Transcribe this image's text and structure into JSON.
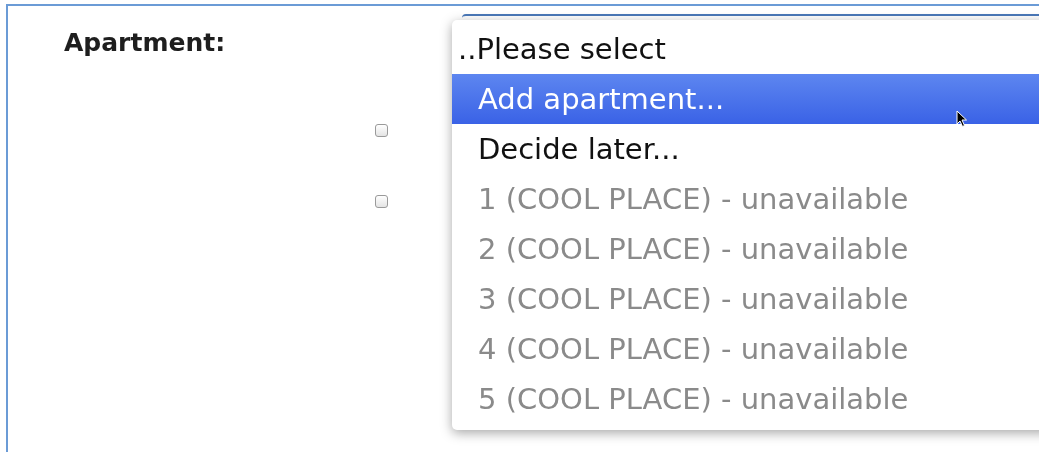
{
  "field": {
    "label": "Apartment:"
  },
  "checkboxes": [
    {
      "checked": false
    },
    {
      "checked": false
    }
  ],
  "dropdown": {
    "options": [
      {
        "kind": "current",
        "label": "..Please select",
        "selected": false,
        "disabled": false
      },
      {
        "kind": "option",
        "label": "Add apartment...",
        "selected": true,
        "disabled": false
      },
      {
        "kind": "option",
        "label": "Decide later...",
        "selected": false,
        "disabled": false
      },
      {
        "kind": "option",
        "label": "1 (COOL PLACE) - unavailable",
        "selected": false,
        "disabled": true
      },
      {
        "kind": "option",
        "label": "2 (COOL PLACE) - unavailable",
        "selected": false,
        "disabled": true
      },
      {
        "kind": "option",
        "label": "3 (COOL PLACE) - unavailable",
        "selected": false,
        "disabled": true
      },
      {
        "kind": "option",
        "label": "4 (COOL PLACE) - unavailable",
        "selected": false,
        "disabled": true
      },
      {
        "kind": "option",
        "label": "5 (COOL PLACE) - unavailable",
        "selected": false,
        "disabled": true
      }
    ]
  }
}
